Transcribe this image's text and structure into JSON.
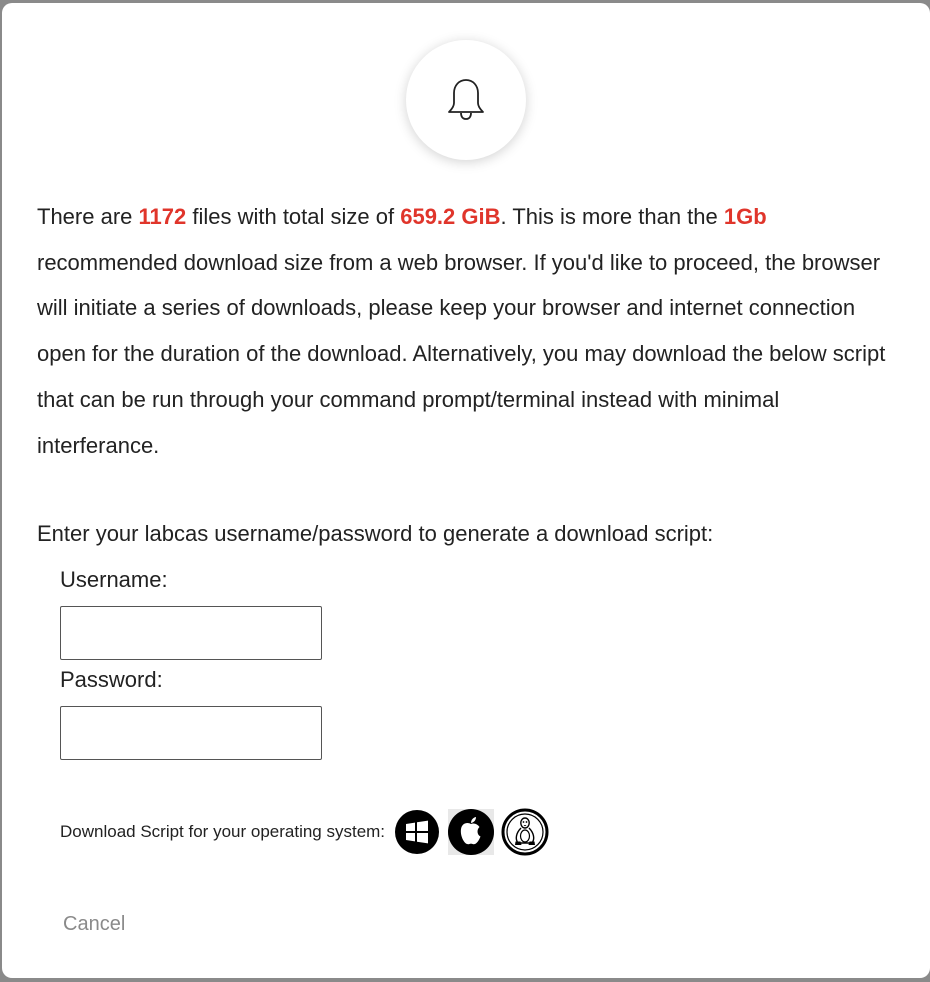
{
  "dialog": {
    "message": {
      "p1": "There are ",
      "file_count": "1172",
      "p2": " files with total size of ",
      "total_size": "659.2 GiB",
      "p3": ". This is more than the ",
      "limit": "1Gb",
      "p4": " recommended download size from a web browser. If you'd like to proceed, the browser will initiate a series of downloads, please keep your browser and internet connection open for the duration of the download. Alternatively, you may download the below script that can be run through your command prompt/terminal instead with minimal interferance."
    },
    "prompt": "Enter your labcas username/password to generate a download script:",
    "username_label": "Username:",
    "username_value": "",
    "password_label": "Password:",
    "password_value": "",
    "os_label": "Download Script for your operating system:",
    "os_icons": [
      "windows-icon",
      "apple-icon",
      "linux-icon"
    ],
    "cancel_label": "Cancel"
  },
  "colors": {
    "highlight": "#e0352b",
    "text": "#222222",
    "muted": "#8a8a8a"
  }
}
